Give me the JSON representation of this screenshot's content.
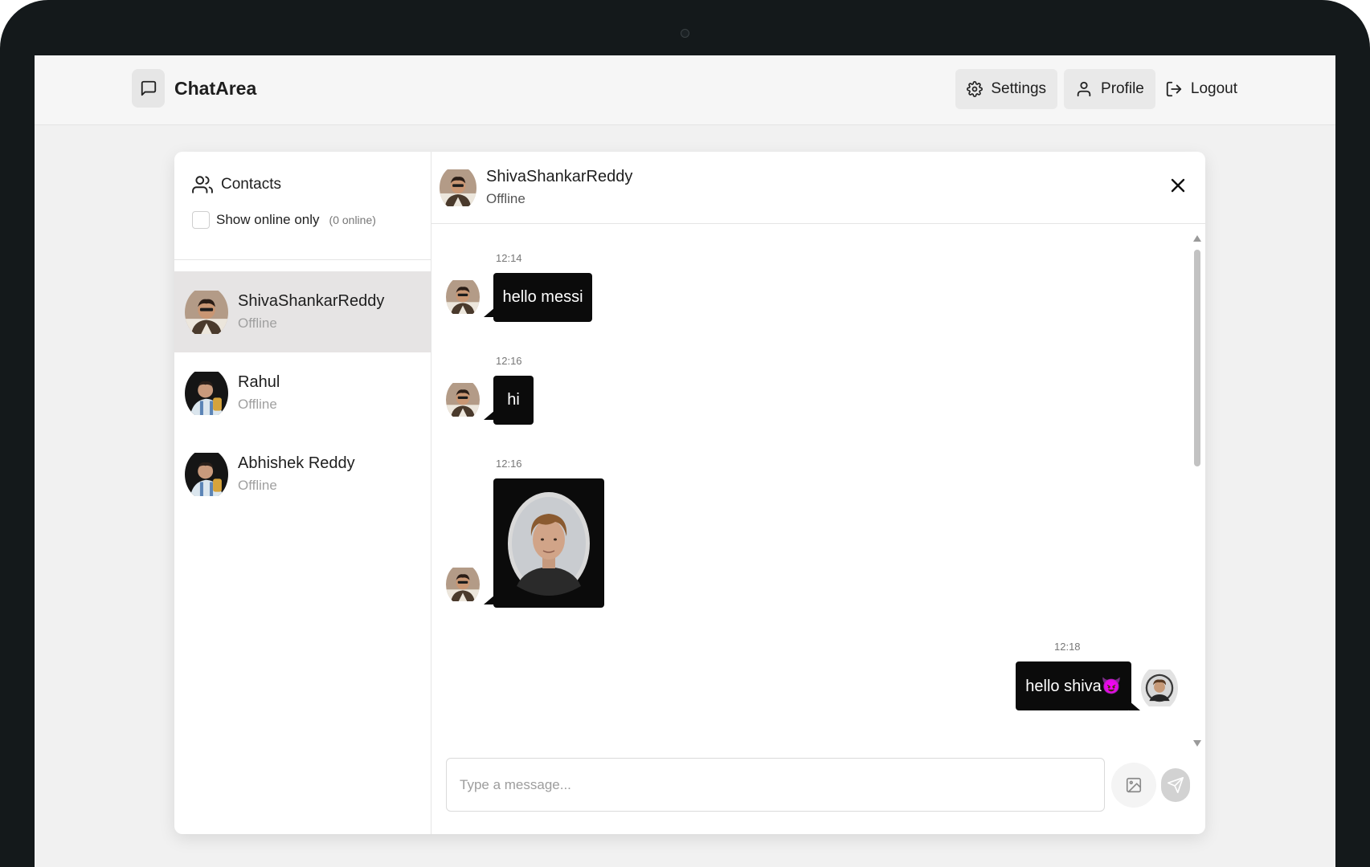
{
  "app": {
    "brand": "ChatArea"
  },
  "nav": {
    "settings": "Settings",
    "profile": "Profile",
    "logout": "Logout"
  },
  "sidebar": {
    "title": "Contacts",
    "filter_label": "Show online only",
    "online_count": "(0 online)",
    "contacts": [
      {
        "name": "ShivaShankarReddy",
        "status": "Offline"
      },
      {
        "name": "Rahul",
        "status": "Offline"
      },
      {
        "name": "Abhishek Reddy",
        "status": "Offline"
      }
    ]
  },
  "chat": {
    "name": "ShivaShankarReddy",
    "status": "Offline",
    "messages": [
      {
        "time": "12:14",
        "text": "hello messi"
      },
      {
        "time": "12:16",
        "text": "hi"
      },
      {
        "time": "12:16"
      },
      {
        "time": "12:18",
        "text": "hello shiva😈"
      }
    ]
  },
  "composer": {
    "placeholder": "Type a message..."
  }
}
